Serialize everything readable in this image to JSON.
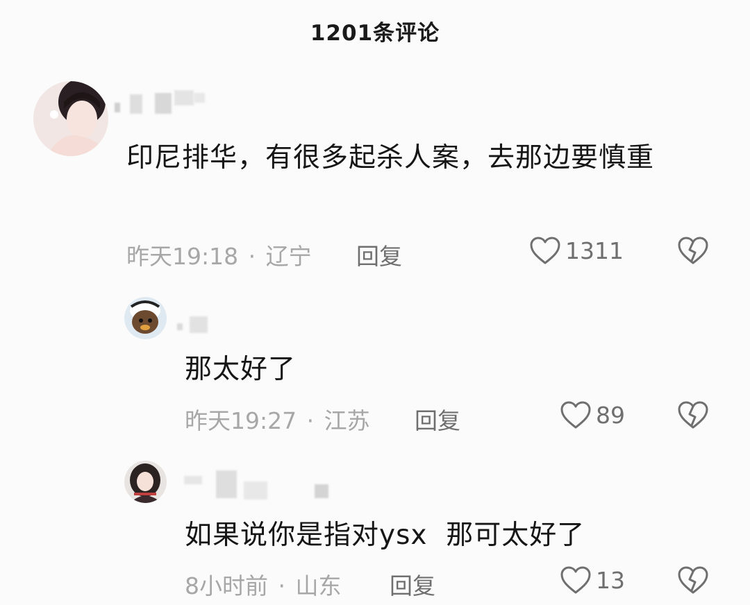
{
  "header": {
    "title": "1201条评论"
  },
  "comments": [
    {
      "text": "印尼排华，有很多起杀人案，去那边要慎重",
      "time": "昨天19:18",
      "location": "辽宁",
      "reply_label": "回复",
      "likes": "1311"
    },
    {
      "text": "那太好了",
      "time": "昨天19:27",
      "location": "江苏",
      "reply_label": "回复",
      "likes": "89"
    },
    {
      "text": "如果说你是指对ysx  那可太好了",
      "time": "8小时前",
      "location": "山东",
      "reply_label": "回复",
      "likes": "13"
    }
  ],
  "meta_separator": "·",
  "icons": {
    "like": "heart-outline-icon",
    "dislike": "broken-heart-icon"
  },
  "colors": {
    "text": "#161616",
    "meta": "#a7a7a7",
    "action": "#6f6f6f"
  }
}
